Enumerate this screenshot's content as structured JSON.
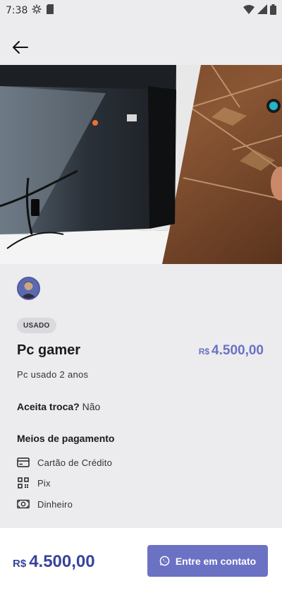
{
  "status_bar": {
    "time": "7:38"
  },
  "listing": {
    "condition": "USADO",
    "title": "Pc gamer",
    "currency": "R$",
    "price": "4.500,00",
    "description": "Pc usado 2 anos",
    "trade_label": "Aceita troca?",
    "trade_value": "Não"
  },
  "payment": {
    "title": "Meios de pagamento",
    "methods": [
      {
        "label": "Cartão de Crédito",
        "icon": "credit-card-icon"
      },
      {
        "label": "Pix",
        "icon": "qr-code-icon"
      },
      {
        "label": "Dinheiro",
        "icon": "cash-icon"
      }
    ]
  },
  "bottom_bar": {
    "currency": "R$",
    "price": "4.500,00",
    "contact_label": "Entre em contato"
  },
  "colors": {
    "accent": "#6B72C4",
    "price_dark": "#37449A",
    "background": "#ECECEF"
  }
}
